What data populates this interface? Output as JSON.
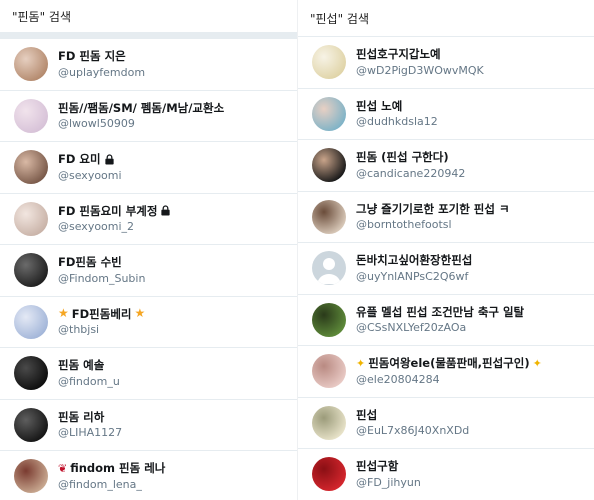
{
  "left": {
    "title": "\"핀돔\" 검색",
    "rows": [
      {
        "name": "FD 핀돔 지은",
        "handle": "@uplayfemdom",
        "icon": "none",
        "avatar": [
          "#b48a6e",
          "#e6cfc0"
        ]
      },
      {
        "name": "핀돔//팸돔/SM/ 펨돔/M남/교환소",
        "handle": "@lwowl50909",
        "icon": "none",
        "avatar": [
          "#d7c2d8",
          "#f1e3ec"
        ]
      },
      {
        "name": "FD 요미",
        "handle": "@sexyoomi",
        "icon": "lock",
        "avatar": [
          "#7a5a4a",
          "#d9b9a5"
        ]
      },
      {
        "name": "FD 핀돔요미 부계정",
        "handle": "@sexyoomi_2",
        "icon": "lock",
        "avatar": [
          "#c9b3a8",
          "#f2e6e0"
        ]
      },
      {
        "name": "FD핀돔 수빈",
        "handle": "@Findom_Subin",
        "icon": "none",
        "avatar": [
          "#202020",
          "#6b6b6b"
        ]
      },
      {
        "name": "FD핀돔베리",
        "handle": "@thbjsi",
        "icon": "stars",
        "avatar": [
          "#a3b6d9",
          "#e4e9f5"
        ]
      },
      {
        "name": "핀돔 예솔",
        "handle": "@findom_u",
        "icon": "none",
        "avatar": [
          "#0e0e0e",
          "#4a4a4a"
        ]
      },
      {
        "name": "핀돔 리하",
        "handle": "@LIHA1127",
        "icon": "none",
        "avatar": [
          "#161616",
          "#5e5e5e"
        ]
      },
      {
        "name": "findom 핀돔 레나",
        "handle": "@findom_lena_",
        "icon": "rose",
        "avatar": [
          "#c8a890",
          "#7a3b30"
        ]
      }
    ]
  },
  "right": {
    "title": "\"핀섭\" 검색",
    "rows": [
      {
        "name": "핀섭호구지갑노예",
        "handle": "@wD2PigD3WOwvMQK",
        "icon": "none",
        "avatar": [
          "#e0d4a8",
          "#f7f3e6"
        ]
      },
      {
        "name": "핀섭 노예",
        "handle": "@dudhkdsla12",
        "icon": "none",
        "avatar": [
          "#7fb3c7",
          "#e8d0c4"
        ]
      },
      {
        "name": "핀돔 (핀섭 구한다)",
        "handle": "@candicane220942",
        "icon": "none",
        "avatar": [
          "#1a1a1a",
          "#c9a48a"
        ]
      },
      {
        "name": "그냥 즐기기로한 포기한 핀섭 ㅋ",
        "handle": "@bornto­thefootsl",
        "icon": "none",
        "avatar": [
          "#d8c8b8",
          "#6a4c3a"
        ]
      },
      {
        "name": "돈바치고싶어환장한핀섭",
        "handle": "@uyYnlANPsC2Q6wf",
        "icon": "default",
        "avatar": [
          "#ccd6dd",
          "#ccd6dd"
        ]
      },
      {
        "name": "유플 멜섭 핀섭 조건만남 축구 일탈",
        "handle": "@CSsNXLYef20zAOa",
        "icon": "none",
        "avatar": [
          "#5e8a3a",
          "#2a3a1a"
        ]
      },
      {
        "name": "핀돔여왕ele(물품판매,핀섭구인)",
        "handle": "@ele20804284",
        "icon": "sparkles",
        "avatar": [
          "#e8c9c4",
          "#b98a82"
        ]
      },
      {
        "name": "핀섭",
        "handle": "@EuL7x86J40XnXDd",
        "icon": "none",
        "avatar": [
          "#e7e2c8",
          "#9b9b7a"
        ]
      },
      {
        "name": "핀섭구함",
        "handle": "@FD_jihyun",
        "icon": "none",
        "avatar": [
          "#d4262d",
          "#8a0f14"
        ]
      }
    ]
  }
}
